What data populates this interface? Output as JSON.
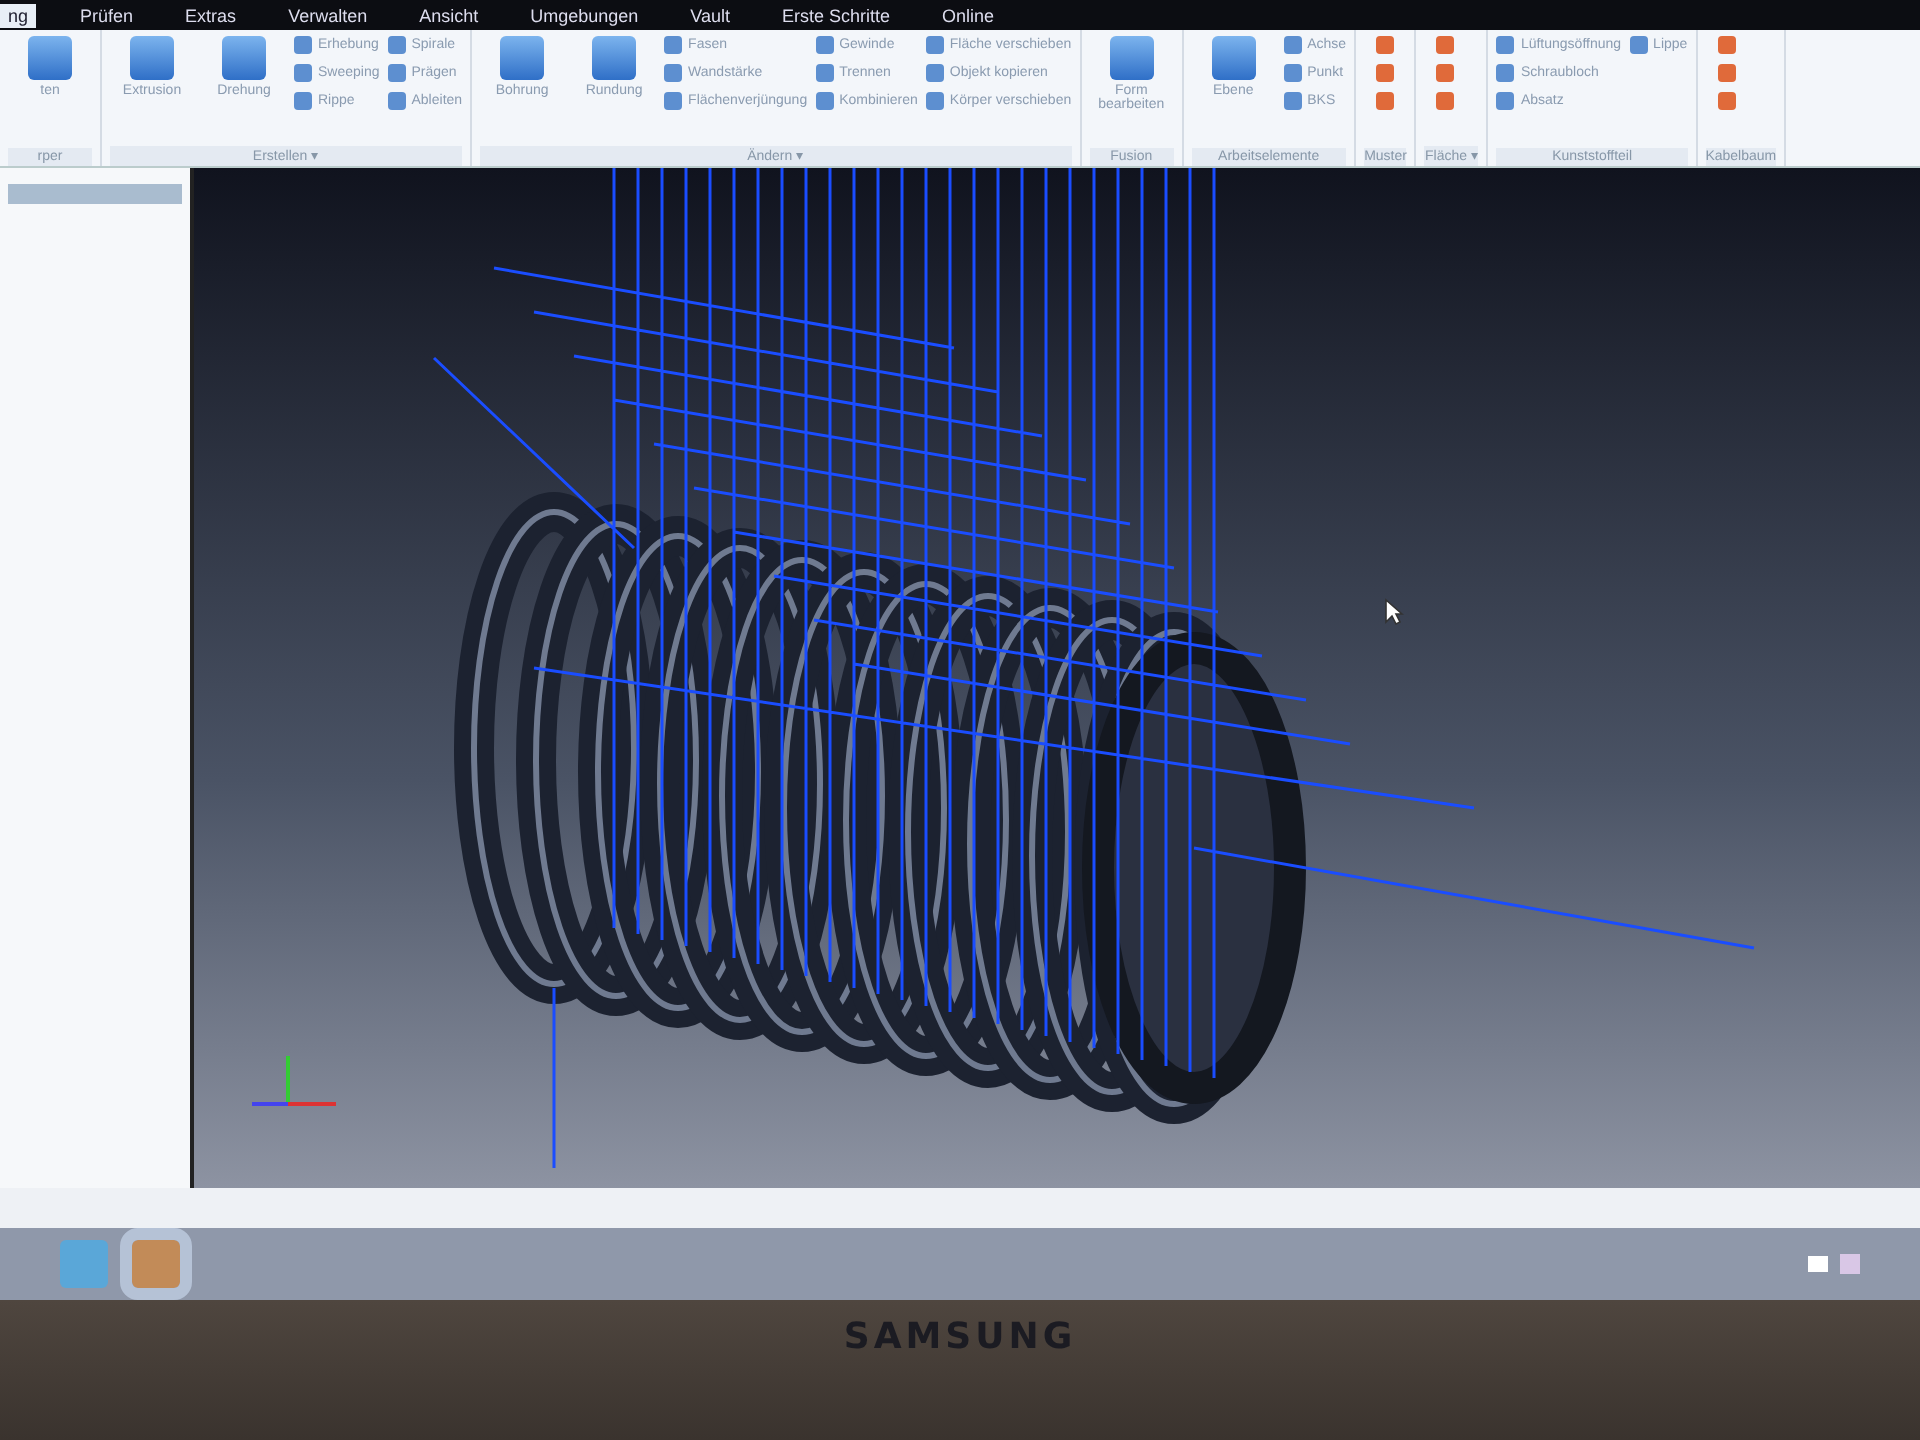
{
  "tabs": [
    {
      "label": "ng",
      "selected": true
    },
    {
      "label": "Prüfen",
      "selected": false
    },
    {
      "label": "Extras",
      "selected": false
    },
    {
      "label": "Verwalten",
      "selected": false
    },
    {
      "label": "Ansicht",
      "selected": false
    },
    {
      "label": "Umgebungen",
      "selected": false
    },
    {
      "label": "Vault",
      "selected": false
    },
    {
      "label": "Erste Schritte",
      "selected": false
    },
    {
      "label": "Online",
      "selected": false
    }
  ],
  "ribbon_groups": [
    {
      "label": "rper",
      "large": [
        {
          "label": "ten"
        }
      ]
    },
    {
      "label": "Erstellen ▾",
      "large": [
        {
          "label": "Extrusion"
        },
        {
          "label": "Drehung"
        }
      ],
      "small": [
        "Erhebung",
        "Sweeping",
        "Rippe",
        "Spirale",
        "Prägen",
        "Ableiten"
      ]
    },
    {
      "label": "Ändern ▾",
      "large": [
        {
          "label": "Bohrung"
        },
        {
          "label": "Rundung"
        }
      ],
      "small": [
        "Fasen",
        "Wandstärke",
        "Flächenverjüngung",
        "Gewinde",
        "Trennen",
        "Kombinieren",
        "Fläche verschieben",
        "Objekt kopieren",
        "Körper verschieben"
      ]
    },
    {
      "label": "Fusion",
      "large": [
        {
          "label": "Form bearbeiten"
        }
      ]
    },
    {
      "label": "Arbeitselemente",
      "large": [
        {
          "label": "Ebene"
        }
      ],
      "small": [
        "Achse",
        "Punkt",
        "BKS"
      ]
    },
    {
      "label": "Muster"
    },
    {
      "label": "Fläche ▾"
    },
    {
      "label": "Kunststoffteil",
      "small": [
        "Lüftungsöffnung",
        "Schraubloch",
        "Absatz",
        "Lippe"
      ]
    },
    {
      "label": "Kabelbaum"
    }
  ],
  "bezel": {
    "brand": "SAMSUNG"
  }
}
